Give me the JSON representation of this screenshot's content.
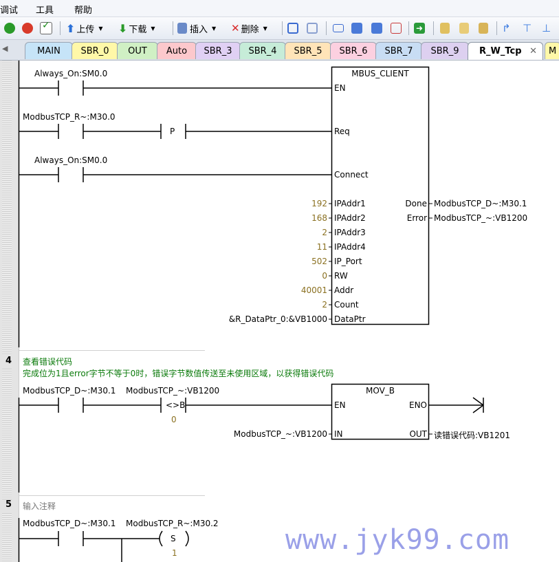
{
  "menu": [
    "调试",
    "工具",
    "帮助"
  ],
  "toolbar": {
    "upload": "上传",
    "download": "下载",
    "insert": "插入",
    "delete": "删除"
  },
  "tabs": [
    "MAIN",
    "SBR_0",
    "OUT",
    "Auto",
    "SBR_3",
    "SBR_4",
    "SBR_5",
    "SBR_6",
    "SBR_7",
    "SBR_9",
    "R_W_Tcp",
    "M"
  ],
  "tab_close": "✕",
  "net3": {
    "contact1": "Always_On:SM0.0",
    "contact2": "ModbusTCP_R~:M30.0",
    "contact3": "Always_On:SM0.0",
    "p_label": "P",
    "block_title": "MBUS_CLIENT",
    "pins_left": [
      "EN",
      "Req",
      "Connect",
      "IPAddr1",
      "IPAddr2",
      "IPAddr3",
      "IPAddr4",
      "IP_Port",
      "RW",
      "Addr",
      "Count",
      "DataPtr"
    ],
    "values": [
      "192",
      "168",
      "2",
      "11",
      "502",
      "0",
      "40001",
      "2"
    ],
    "dataptr": "&R_DataPtr_0:&VB1000",
    "pins_right": [
      "Done",
      "Error"
    ],
    "outputs": [
      "ModbusTCP_D~:M30.1",
      "ModbusTCP_~:VB1200"
    ]
  },
  "net4": {
    "num": "4",
    "title": "查看错误代码",
    "comment": "完成位为1且error字节不等于0时，错误字节数值传送至未使用区域，以获得错误代码",
    "contact1": "ModbusTCP_D~:M30.1",
    "contact2": "ModbusTCP_~:VB1200",
    "cmp": "<>B",
    "cmp_value": "0",
    "block_title": "MOV_B",
    "pin_en": "EN",
    "pin_eno": "ENO",
    "pin_in": "IN",
    "pin_out": "OUT",
    "in_operand": "ModbusTCP_~:VB1200",
    "out_operand": "读错误代码:VB1201"
  },
  "net5": {
    "num": "5",
    "comment": "输入注释",
    "contact1": "ModbusTCP_D~:M30.1",
    "coil": "ModbusTCP_R~:M30.2",
    "coil_type": "S",
    "coil_value": "1"
  },
  "watermark": "www.jyk99.com"
}
